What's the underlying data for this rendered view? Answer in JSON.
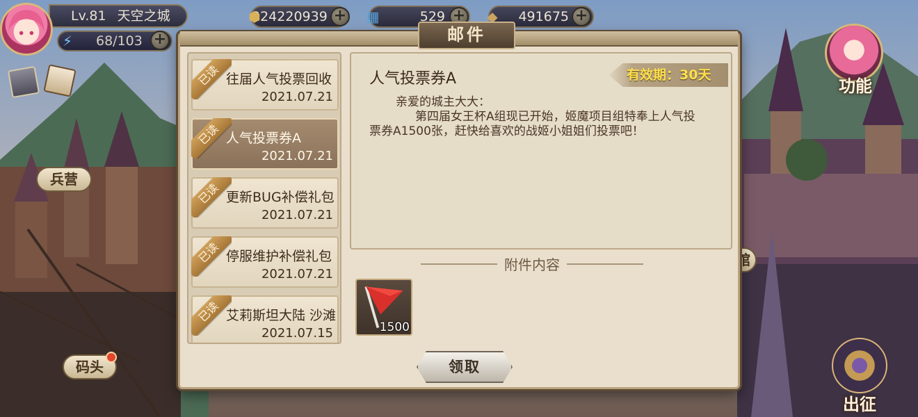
{
  "hud": {
    "level": "Lv.81",
    "city_name": "天空之城",
    "energy": "68/103",
    "resources": [
      {
        "icon": "gold-coin-icon",
        "value": "224220939"
      },
      {
        "icon": "ticket-icon",
        "value": "529"
      },
      {
        "icon": "crystal-icon",
        "value": "491675"
      }
    ],
    "plus": "+"
  },
  "side_buttons": {
    "barracks": "兵营",
    "dock": "码头",
    "function": "功能",
    "depart": "出征",
    "hall_partial": "馆"
  },
  "dialog": {
    "title": "邮件",
    "mail_list": [
      {
        "status": "已读",
        "title": "往届人气投票回收",
        "date": "2021.07.21",
        "selected": false
      },
      {
        "status": "已读",
        "title": "人气投票券A",
        "date": "2021.07.21",
        "selected": true
      },
      {
        "status": "已读",
        "title": "更新BUG补偿礼包",
        "date": "2021.07.21",
        "selected": false
      },
      {
        "status": "已读",
        "title": "停服维护补偿礼包",
        "date": "2021.07.21",
        "selected": false
      },
      {
        "status": "已读",
        "title": "艾莉斯坦大陆 沙滩",
        "date": "2021.07.15",
        "selected": false
      }
    ],
    "content": {
      "subject": "人气投票券A",
      "validity": "有效期：30天",
      "greeting": "亲爱的城主大大：",
      "body_line1": "第四届女王杯A组现已开始，姬魔项目组特奉上人气投",
      "body_line2": "票券A1500张，赶快给喜欢的战姬小姐姐们投票吧！"
    },
    "attachment_title": "附件内容",
    "attachments": [
      {
        "icon": "red-flag-icon",
        "count": "1500"
      }
    ],
    "claim_label": "领取"
  },
  "colors": {
    "accent_gold": "#ffe04a",
    "panel": "#e9dfcc",
    "selected_item": "#8a7159"
  }
}
